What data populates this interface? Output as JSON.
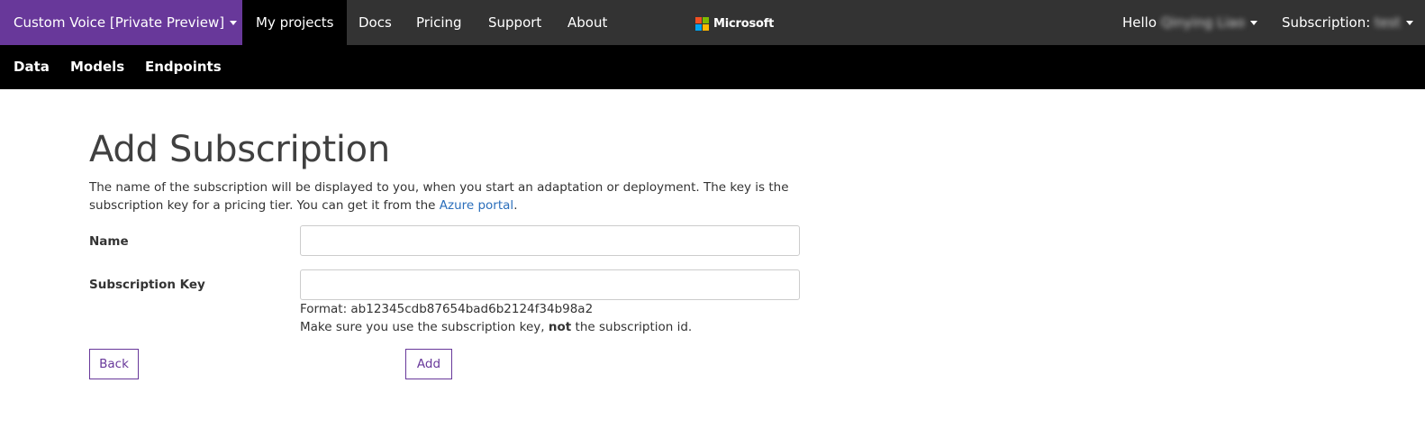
{
  "topnav": {
    "brand_label": "Custom Voice [Private Preview]",
    "items": [
      "My projects",
      "Docs",
      "Pricing",
      "Support",
      "About"
    ],
    "microsoft_label": "Microsoft",
    "hello_prefix": "Hello",
    "hello_user": "Qinying Liao",
    "subscription_prefix": "Subscription:",
    "subscription_value": "test"
  },
  "subnav": {
    "items": [
      "Data",
      "Models",
      "Endpoints"
    ]
  },
  "page": {
    "title": "Add Subscription",
    "description_text": "The name of the subscription will be displayed to you, when you start an adaptation or deployment. The key is the subscription key for a pricing tier. You can get it from the",
    "description_link": "Azure portal",
    "description_end": ".",
    "form": {
      "name_label": "Name",
      "name_value": "",
      "key_label": "Subscription Key",
      "key_value": "",
      "format_text": "Format: ab12345cdb87654bad6b2124f34b98a2",
      "hint_before": "Make sure you use the subscription key,",
      "hint_bold": "not",
      "hint_after": "the subscription id."
    },
    "buttons": {
      "back": "Back",
      "add": "Add"
    }
  },
  "colors": {
    "brand_purple": "#68389a",
    "topbar": "#333333",
    "subbar": "#000000",
    "link": "#2a6ebb",
    "ms_red": "#f25022",
    "ms_green": "#7fba00",
    "ms_blue": "#00a4ef",
    "ms_yellow": "#ffb900"
  }
}
